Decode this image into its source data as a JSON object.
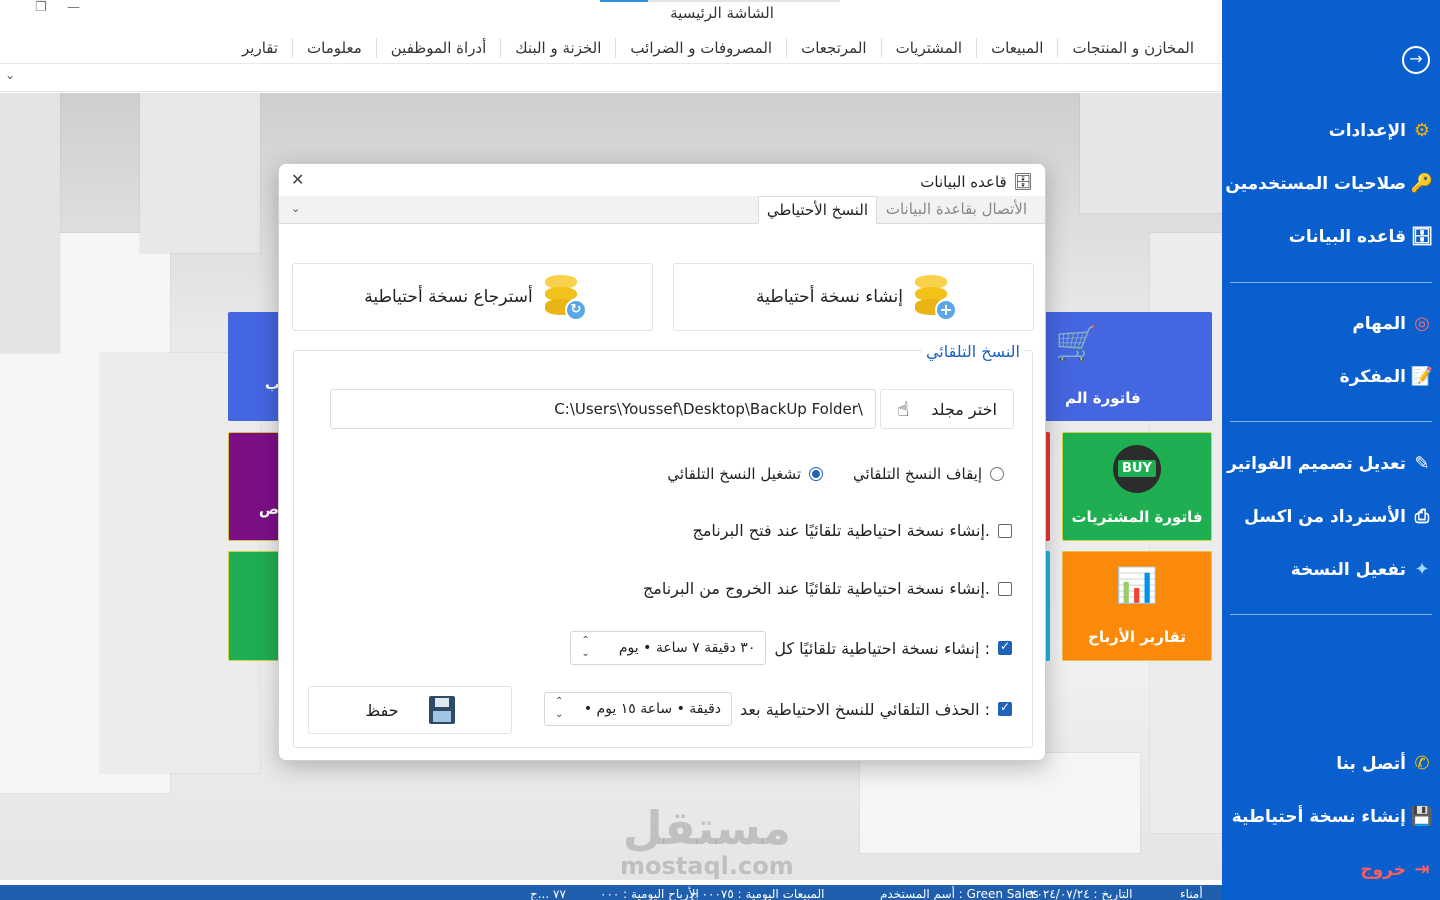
{
  "window": {
    "title": "الشاشة الرئيسية",
    "minimize_icon": "—",
    "restore_icon": "❐"
  },
  "menu": [
    "المخازن و المنتجات",
    "المبيعات",
    "المشتريات",
    "المرتجعات",
    "المصروفات و الضرائب",
    "الخزنة و البنك",
    "أدراة الموظفين",
    "معلومات",
    "تقارير"
  ],
  "tiles": {
    "purchase_invoice_partial": "فاتورة الم",
    "purchases_invoice": "فاتورة المشتريات",
    "profit_reports": "تقارير الأرباح",
    "buy_badge": "BUY",
    "partial_left_purple": "ص",
    "partial_left_blue": "ب",
    "colors": {
      "blue": "#4466e0",
      "green": "#1fae52",
      "orange": "#fb8a0b",
      "purple": "#7c0f86",
      "red": "#e53935",
      "cyan": "#1fb6e0"
    }
  },
  "sidebar": {
    "back_icon": "→",
    "items": [
      {
        "label": "الإعدادات",
        "icon": "⚙"
      },
      {
        "label": "صلاحيات المستخدمين",
        "icon": "🔑"
      },
      {
        "label": "قاعده البيانات",
        "icon": "🗄"
      },
      {
        "label": "المهام",
        "icon": "◎"
      },
      {
        "label": "المفكرة",
        "icon": "📝"
      },
      {
        "label": "تعديل تصميم الفواتير",
        "icon": "✎"
      },
      {
        "label": "الأسترداد من اكسل",
        "icon": "⎙"
      },
      {
        "label": "تفعيل النسخة",
        "icon": "✦"
      },
      {
        "label": "أتصل بنا",
        "icon": "✆"
      },
      {
        "label": "إنشاء نسخة أحتياطية",
        "icon": "💾"
      },
      {
        "label": "خروج",
        "icon": "⇥"
      }
    ],
    "bg": "#0a5fce"
  },
  "dialog": {
    "title": "قاعده البيانات",
    "close_icon": "✕",
    "tabs": {
      "connection": "الأتصال بقاعدة البيانات",
      "backup": "النسخ الأحتياطي"
    },
    "create_backup": "إنشاء نسخة أحتياطية",
    "restore_backup": "أسترجاع نسخة أحتياطية",
    "auto_group_title": "النسخ التلقائي",
    "folder_path": "C:\\Users\\Youssef\\Desktop\\BackUp Folder\\",
    "choose_folder": "اختر مجلد",
    "radio_stop": "إيقاف النسخ التلقائي",
    "radio_start": "تشغيل النسخ التلقائي",
    "radio_selected": "start",
    "chk_on_open": "إنشاء نسخة احتياطية تلقائيًا عند فتح البرنامج.",
    "chk_on_exit": "إنشاء نسخة احتياطية تلقائيًا عند الخروج من البرنامج.",
    "chk_every": "إنشاء نسخة احتياطية تلقائيًا كل :",
    "every_value": "٣٠ دقيقة ٧ ساعة • يوم",
    "chk_delete_after": "الحذف التلقائي للنسخ الاحتياطية بعد :",
    "delete_value": "• دقيقة • ساعة ١٥ يوم",
    "save": "حفظ",
    "accent": "#1e63b8"
  },
  "status": {
    "left_part": "٧٧ ...ج",
    "daily_profit": "الأرباح اليومية : ٠٠٠",
    "daily_sales": "المبيعات اليومية : ٠٠٠٧٥ ج",
    "user": "أسم المستخدم : Green Sales",
    "date": "التاريخ : ٢٠٢٤/٠٧/٢٤",
    "cashier": "أمناء"
  },
  "watermark": {
    "arabic": "مستقل",
    "latin": "mostaql.com"
  }
}
